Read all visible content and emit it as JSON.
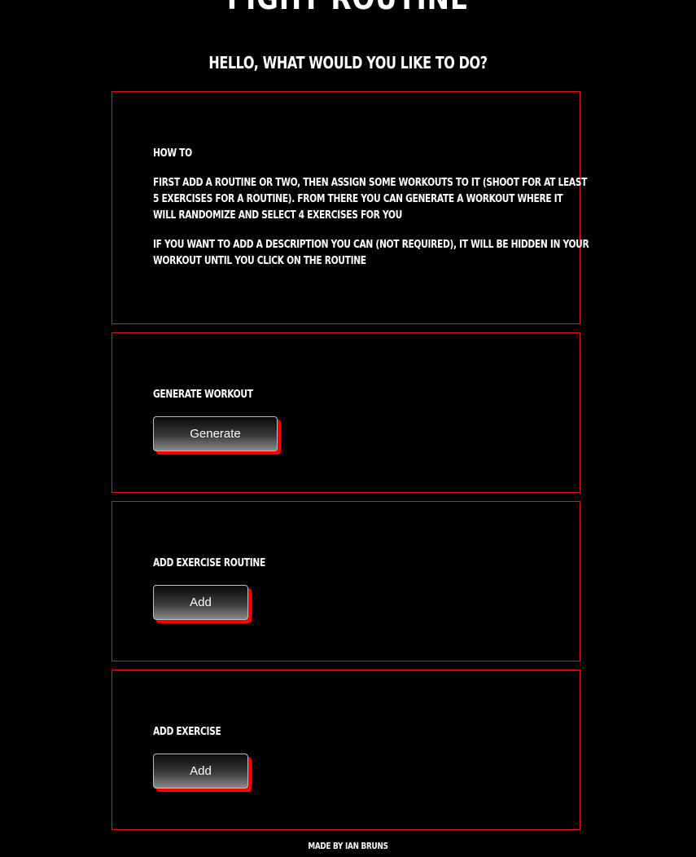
{
  "header": {
    "title": "Fight Routine",
    "greeting": "Hello, what would you like to do?"
  },
  "howto": {
    "heading": "How To",
    "paragraph1_lines": [
      "First add a routine or two, then assign some workouts to it (shoot for at least",
      "5 exercises for a routine). From there you can generate a workout where it",
      "will randomize and select 4 exercises for you"
    ],
    "paragraph2_lines": [
      "If you want to add a description you can (not required), it will be hidden in your",
      "workout until you click on the routine"
    ]
  },
  "generate": {
    "label": "Generate Workout",
    "button": "Generate"
  },
  "add_routine": {
    "label": "Add Exercise Routine",
    "button": "Add"
  },
  "add_exercise": {
    "label": "Add Exercise",
    "button": "Add"
  },
  "footer": {
    "credit": "Made by Ian Bruns"
  },
  "colors": {
    "background": "#000000",
    "accent": "#e0161c",
    "text": "#ffffff"
  }
}
